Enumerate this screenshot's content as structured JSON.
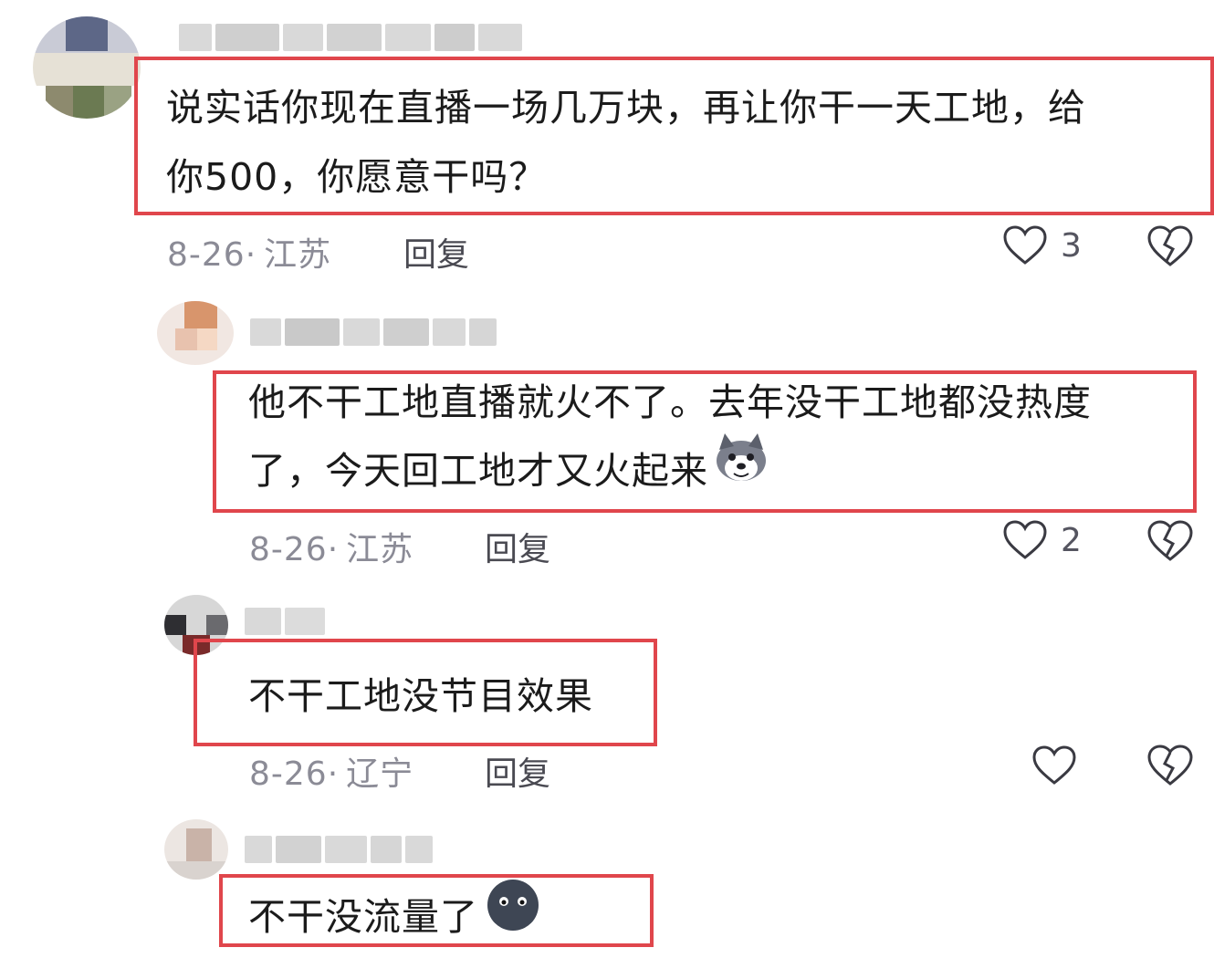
{
  "comments": [
    {
      "text_line1": "说实话你现在直播一场几万块，再让你干一天工地，给",
      "text_line2": "你500，你愿意干吗？",
      "date": "8-26·",
      "location": "江苏",
      "reply_label": "回复",
      "likes": "3"
    },
    {
      "text_line1": "他不干工地直播就火不了。去年没干工地都没热度",
      "text_line2": "了，今天回工地才又火起来",
      "emoji_icon": "husky-dog-emoji-icon",
      "date": "8-26·",
      "location": "江苏",
      "reply_label": "回复",
      "likes": "2"
    },
    {
      "text_line1": "不干工地没节目效果",
      "date": "8-26·",
      "location": "辽宁",
      "reply_label": "回复",
      "likes": ""
    },
    {
      "text_line1": "不干没流量了",
      "emoji_icon": "dark-face-emoji-icon"
    }
  ],
  "colors": {
    "highlight_border": "#e0464c",
    "meta_text": "#8b8b96",
    "body_text": "#1b1b1b"
  }
}
